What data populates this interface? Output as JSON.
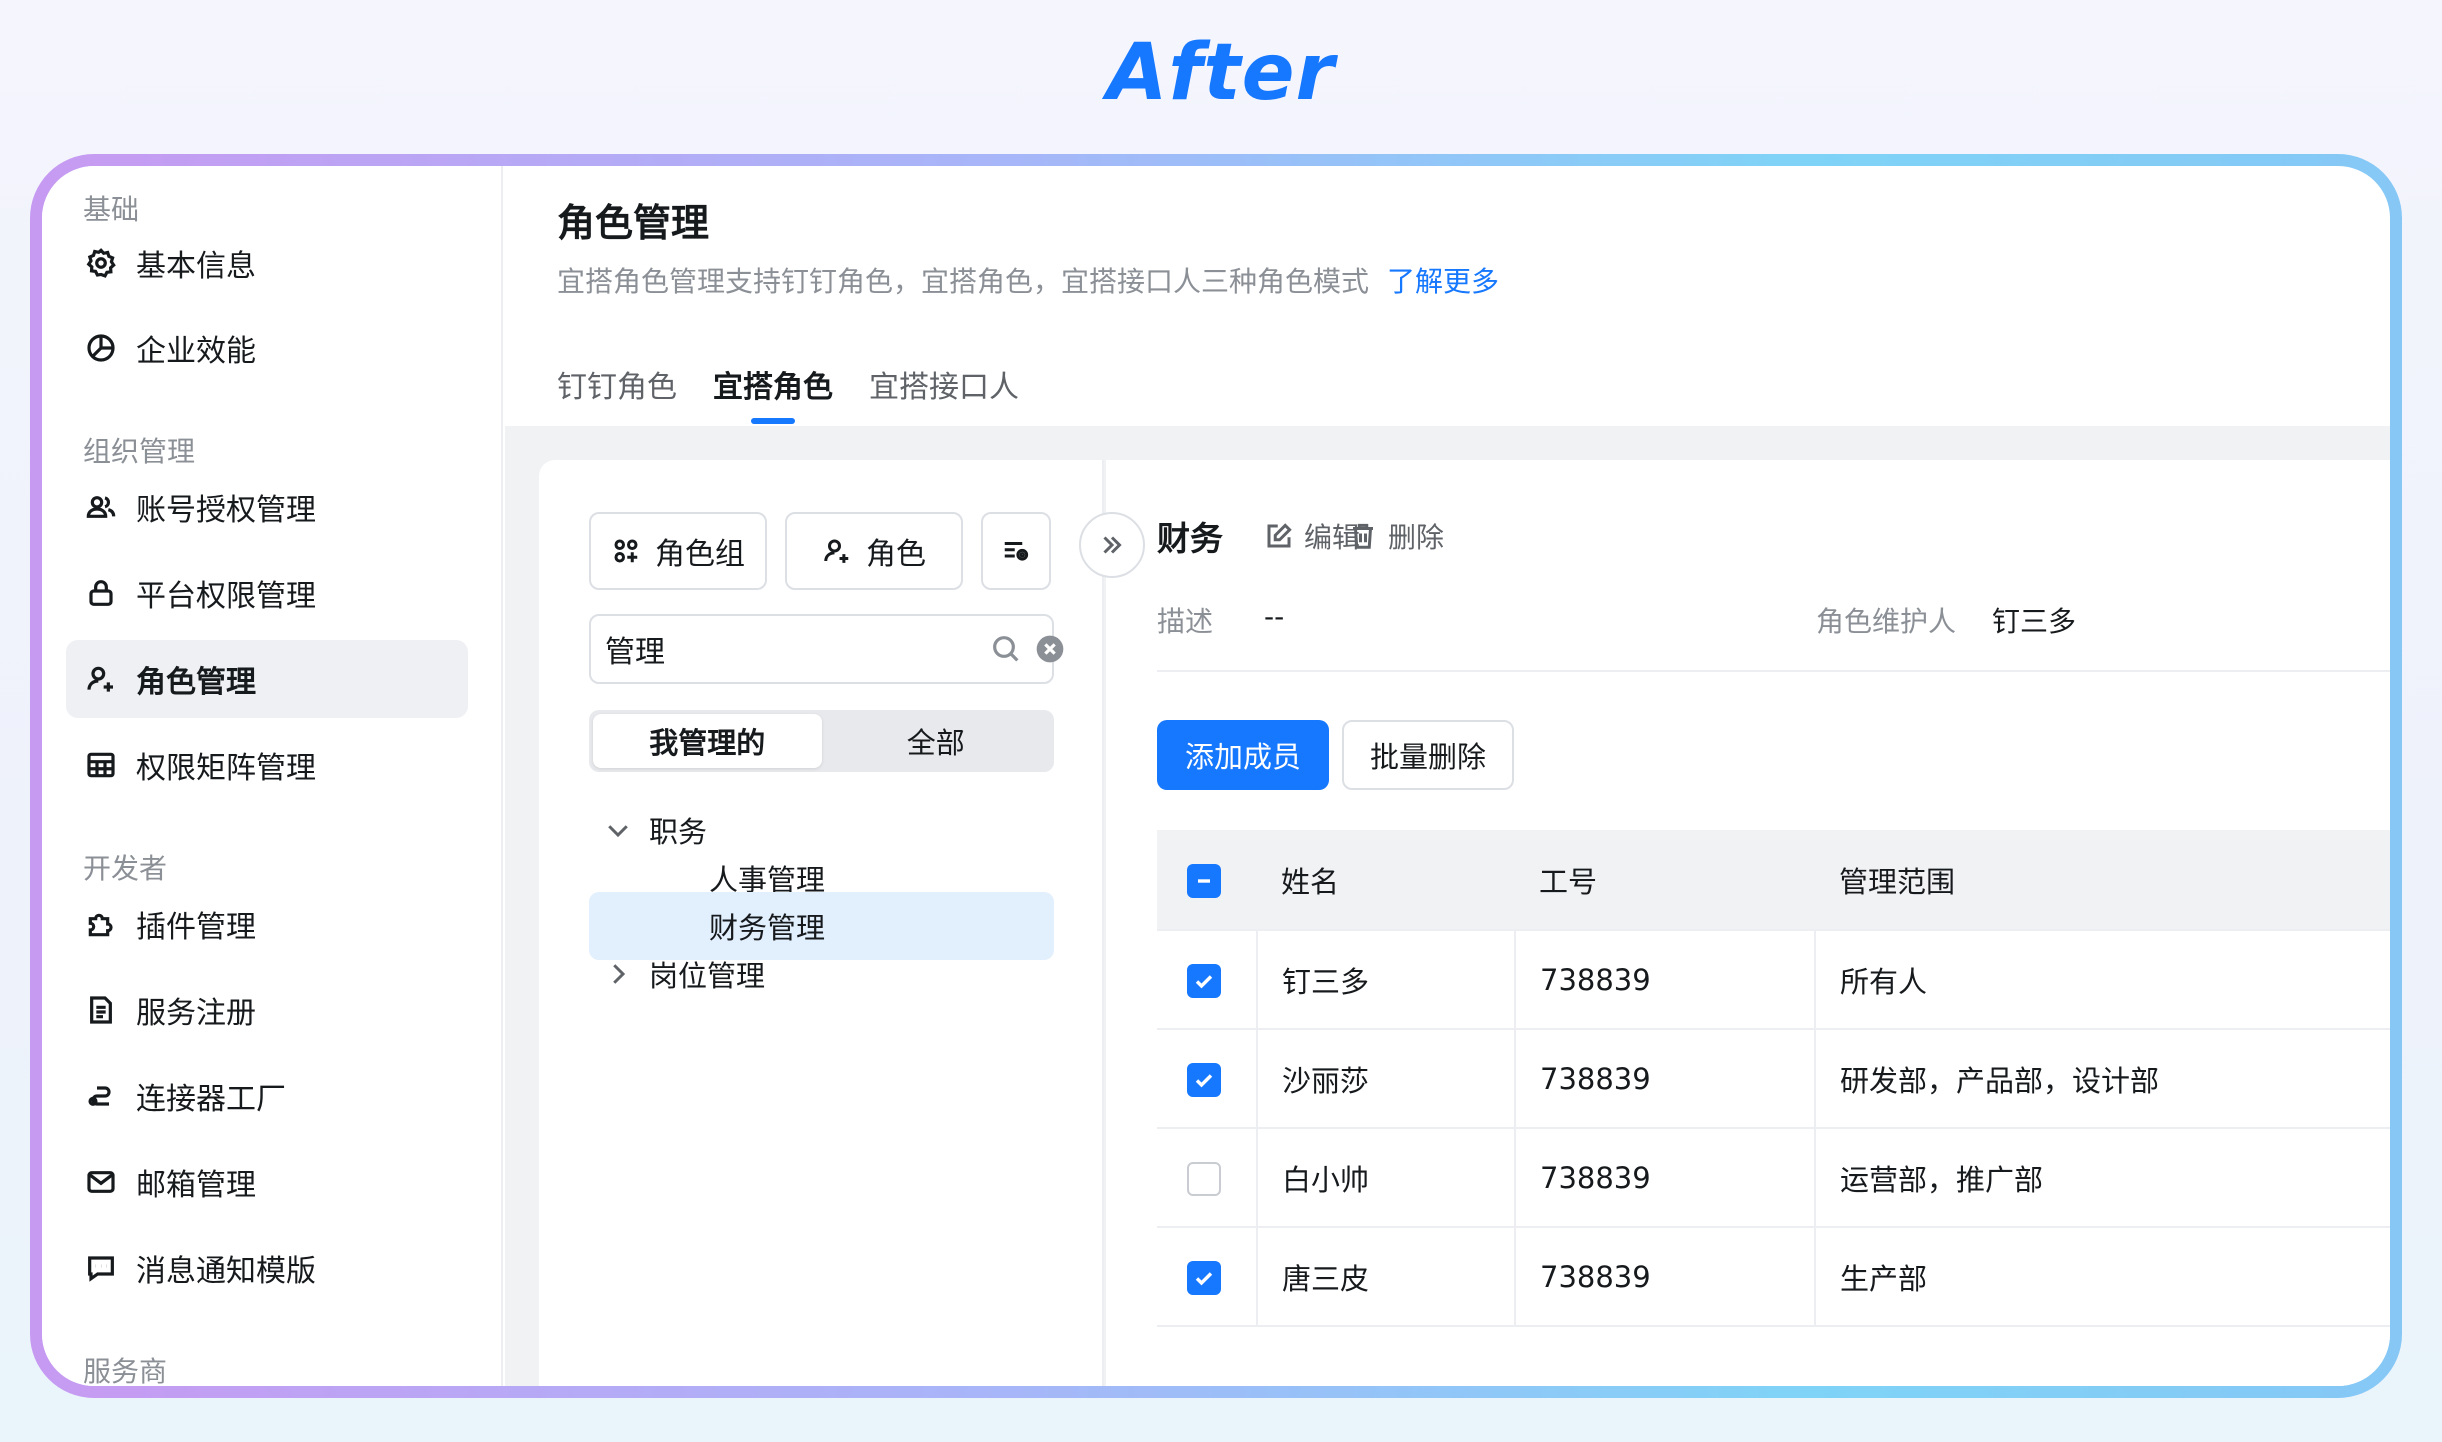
{
  "heading": "After",
  "sidebar": {
    "groups": {
      "basic": "基础",
      "org": "组织管理",
      "dev": "开发者",
      "provider": "服务商"
    },
    "items": [
      {
        "label": "基本信息",
        "icon": "gear-icon"
      },
      {
        "label": "企业效能",
        "icon": "pie-chart-icon"
      },
      {
        "label": "账号授权管理",
        "icon": "users-icon"
      },
      {
        "label": "平台权限管理",
        "icon": "lock-icon"
      },
      {
        "label": "角色管理",
        "icon": "user-role-icon",
        "active": true
      },
      {
        "label": "权限矩阵管理",
        "icon": "table-icon"
      },
      {
        "label": "插件管理",
        "icon": "puzzle-icon"
      },
      {
        "label": "服务注册",
        "icon": "document-icon"
      },
      {
        "label": "连接器工厂",
        "icon": "connector-icon"
      },
      {
        "label": "邮箱管理",
        "icon": "mail-icon"
      },
      {
        "label": "消息通知模版",
        "icon": "message-icon"
      }
    ]
  },
  "header": {
    "title": "角色管理",
    "description": "宜搭角色管理支持钉钉角色，宜搭角色，宜搭接口人三种角色模式",
    "learn_more": "了解更多",
    "tabs": [
      {
        "label": "钉钉角色",
        "active": false
      },
      {
        "label": "宜搭角色",
        "active": true
      },
      {
        "label": "宜搭接口人",
        "active": false
      }
    ]
  },
  "left_panel": {
    "role_group_btn": "角色组",
    "role_btn": "角色",
    "search": {
      "value": "管理",
      "placeholder": ""
    },
    "segment": {
      "mine": "我管理的",
      "all": "全部",
      "selected": "mine"
    },
    "tree": [
      {
        "label": "职务",
        "level": 0,
        "expanded": true
      },
      {
        "label": "人事管理",
        "level": 1
      },
      {
        "label": "财务管理",
        "level": 1,
        "selected": true
      },
      {
        "label": "岗位管理",
        "level": 0,
        "expanded": false
      }
    ]
  },
  "detail": {
    "title": "财务",
    "edit": "编辑",
    "delete": "删除",
    "desc_label": "描述",
    "desc_value": "--",
    "maintainer_label": "角色维护人",
    "maintainer_value": "钉三多",
    "add_member": "添加成员",
    "batch_delete": "批量删除",
    "columns": [
      "姓名",
      "工号",
      "管理范围"
    ],
    "rows": [
      {
        "name": "钉三多",
        "id": "738839",
        "scope": "所有人",
        "checked": true
      },
      {
        "name": "沙丽莎",
        "id": "738839",
        "scope": "研发部，产品部，设计部",
        "checked": true
      },
      {
        "name": "白小帅",
        "id": "738839",
        "scope": "运营部，推广部",
        "checked": false
      },
      {
        "name": "唐三皮",
        "id": "738839",
        "scope": "生产部",
        "checked": true
      }
    ]
  },
  "colors": {
    "accent": "#1677ff",
    "selected_bg": "#e2effd"
  }
}
